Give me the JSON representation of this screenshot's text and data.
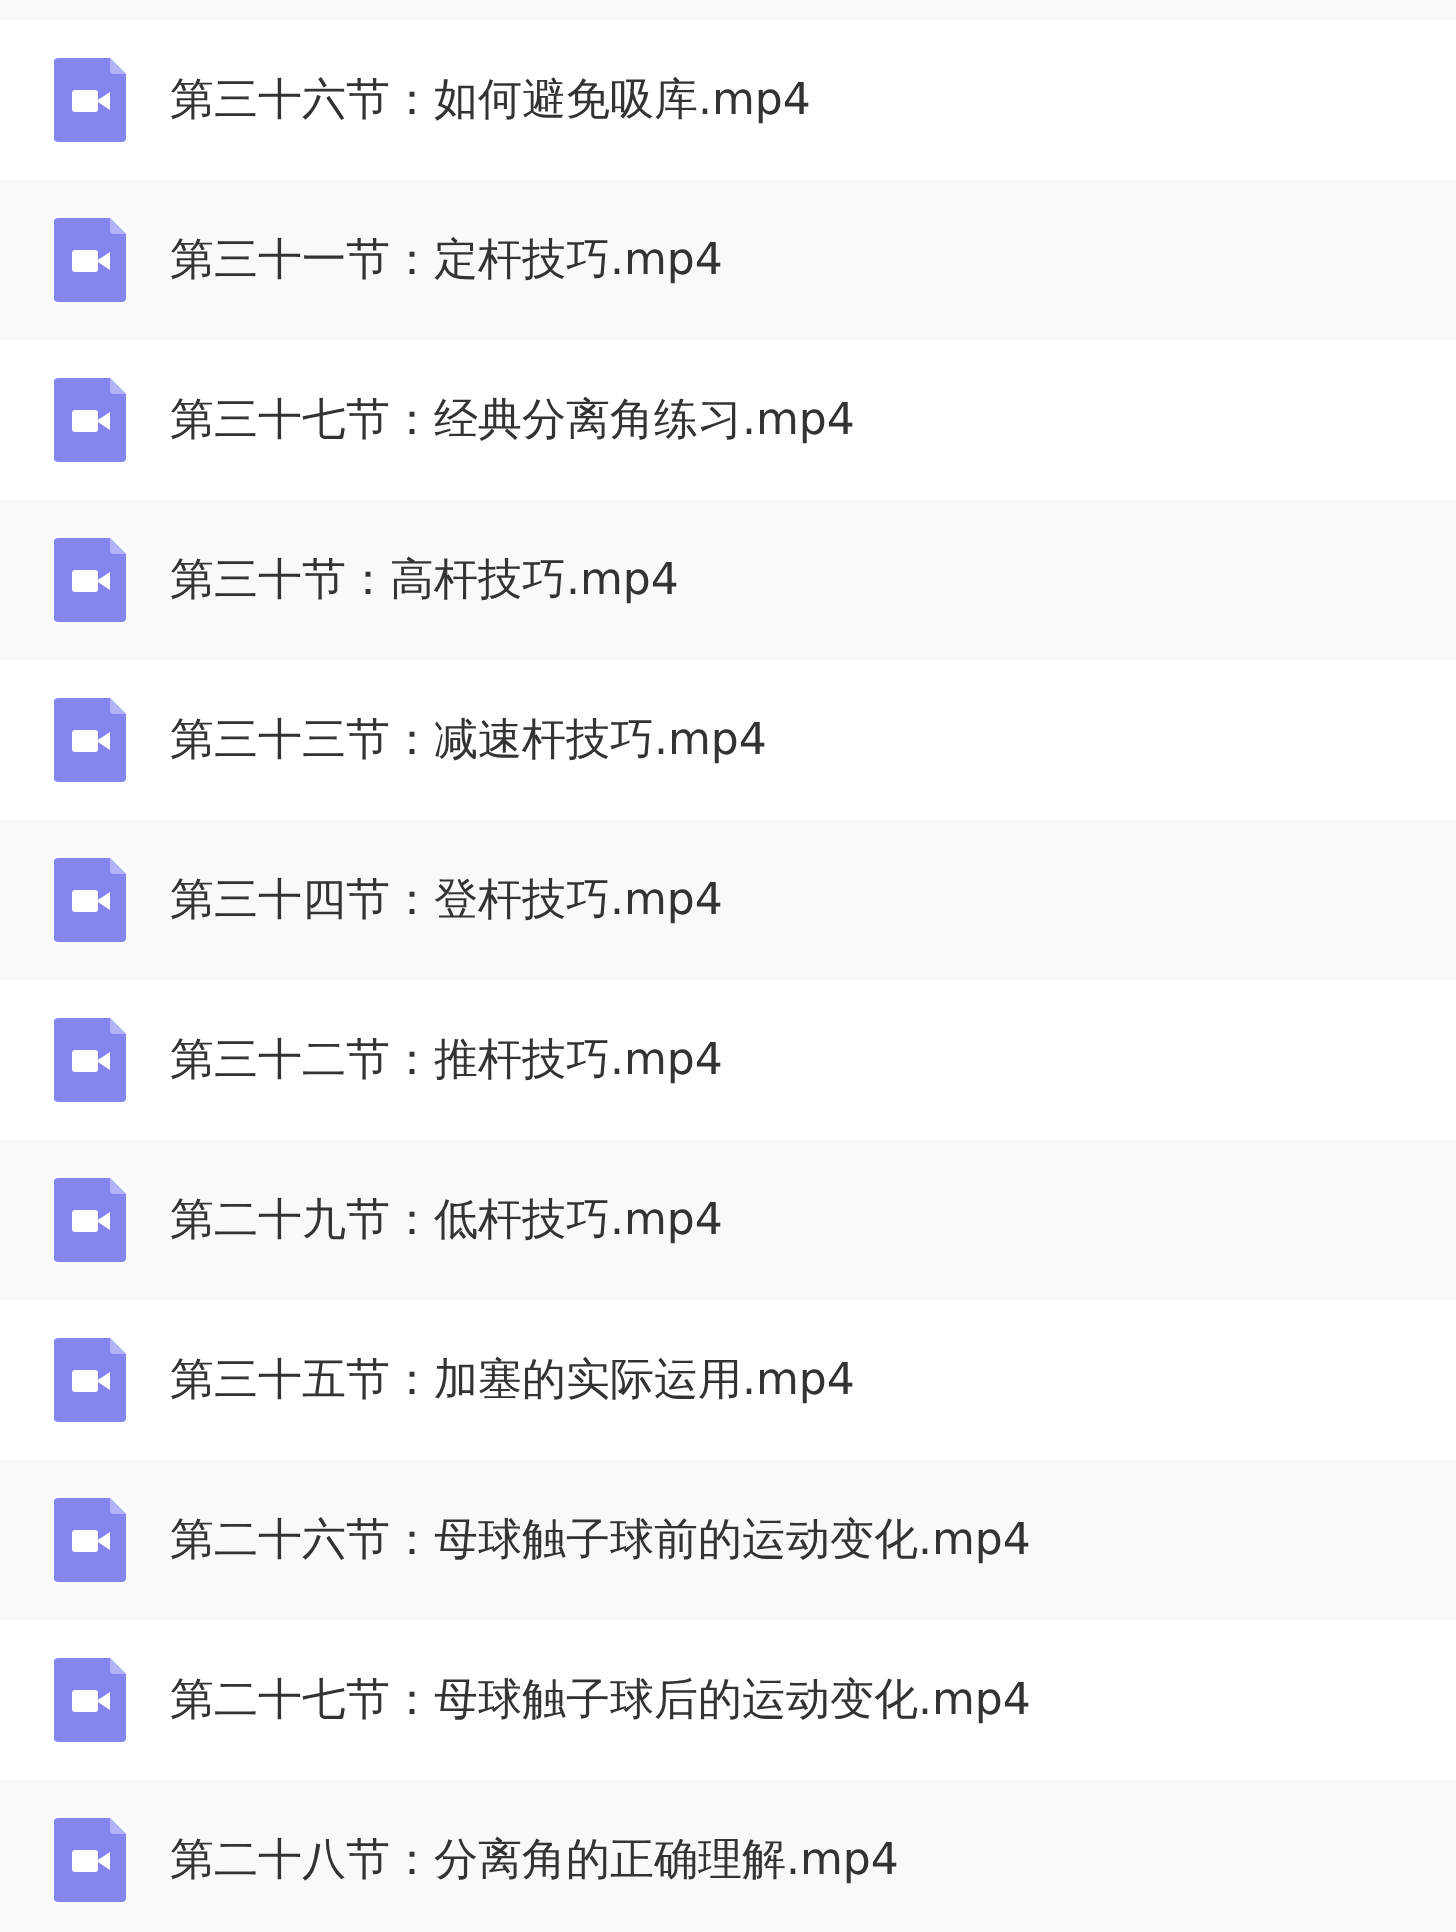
{
  "files": [
    {
      "name": "第三十六节：如何避免吸库.mp4"
    },
    {
      "name": "第三十一节：定杆技巧.mp4"
    },
    {
      "name": "第三十七节：经典分离角练习.mp4"
    },
    {
      "name": "第三十节：高杆技巧.mp4"
    },
    {
      "name": "第三十三节：减速杆技巧.mp4"
    },
    {
      "name": "第三十四节：登杆技巧.mp4"
    },
    {
      "name": "第三十二节：推杆技巧.mp4"
    },
    {
      "name": "第二十九节：低杆技巧.mp4"
    },
    {
      "name": "第三十五节：加塞的实际运用.mp4"
    },
    {
      "name": "第二十六节：母球触子球前的运动变化.mp4"
    },
    {
      "name": "第二十七节：母球触子球后的运动变化.mp4"
    },
    {
      "name": "第二十八节：分离角的正确理解.mp4"
    }
  ]
}
